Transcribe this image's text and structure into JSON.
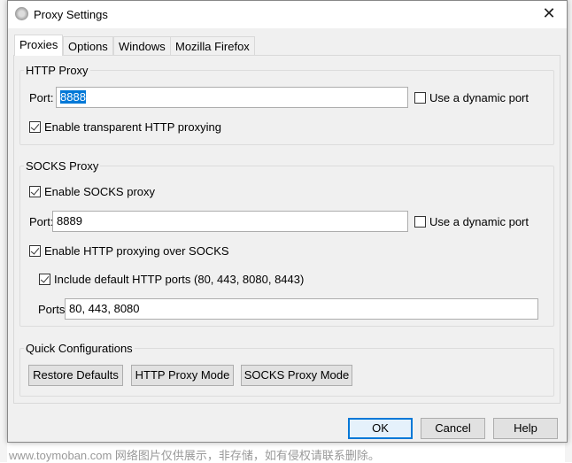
{
  "window": {
    "title": "Proxy Settings",
    "close_icon": "close-icon"
  },
  "tabs": [
    {
      "label": "Proxies",
      "active": true
    },
    {
      "label": "Options"
    },
    {
      "label": "Windows"
    },
    {
      "label": "Mozilla Firefox"
    }
  ],
  "http_proxy": {
    "group_label": "HTTP Proxy",
    "port_label": "Port:",
    "port_value": "8888",
    "dynamic_port_label": "Use a dynamic port",
    "dynamic_port_checked": false,
    "transparent_label": "Enable transparent HTTP proxying",
    "transparent_checked": true
  },
  "socks_proxy": {
    "group_label": "SOCKS Proxy",
    "enable_label": "Enable SOCKS proxy",
    "enable_checked": true,
    "port_label": "Port:",
    "port_value": "8889",
    "dynamic_port_label": "Use a dynamic port",
    "dynamic_port_checked": false,
    "http_over_socks_label": "Enable HTTP proxying over SOCKS",
    "http_over_socks_checked": true,
    "include_default_label": "Include default HTTP ports (80, 443, 8080, 8443)",
    "include_default_checked": true,
    "ports_label": "Ports:",
    "ports_value": "80, 443, 8080"
  },
  "quick": {
    "group_label": "Quick Configurations",
    "restore": "Restore Defaults",
    "http_mode": "HTTP Proxy Mode",
    "socks_mode": "SOCKS Proxy Mode"
  },
  "footer": {
    "ok": "OK",
    "cancel": "Cancel",
    "help": "Help"
  },
  "watermark": "www.toymoban.com 网络图片仅供展示，非存储，如有侵权请联系删除。",
  "colors": {
    "accent": "#0078d7"
  }
}
